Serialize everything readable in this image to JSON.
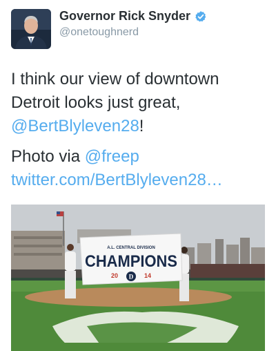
{
  "user": {
    "display_name": "Governor Rick Snyder",
    "handle": "@onetoughnerd",
    "verified_icon": "verified-badge-icon",
    "avatar_icon": "profile-photo"
  },
  "tweet": {
    "line1_text": "I think our view of downtown Detroit looks just great, ",
    "line1_mention": "@BertBlyleven28",
    "line1_end": "!",
    "line2_text": "Photo via ",
    "line2_mention": "@freep",
    "line2_link": "twitter.com/BertBlyleven28…"
  },
  "photo": {
    "banner_top": "A.L. CENTRAL DIVISION",
    "banner_main": "CHAMPIONS",
    "banner_year_left": "20",
    "banner_year_right": "14",
    "banner_logo": "D"
  },
  "colors": {
    "link": "#55acee",
    "verified": "#55acee",
    "text": "#292f33",
    "secondary": "#8899a6"
  }
}
